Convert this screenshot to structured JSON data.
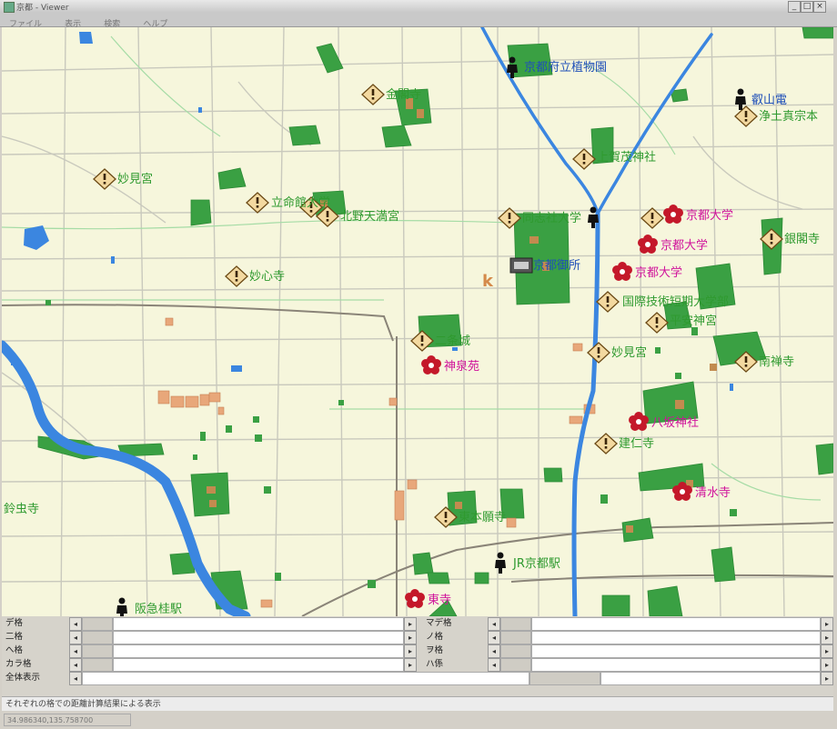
{
  "window": {
    "title": "京都 - Viewer"
  },
  "menu": [
    "ファイル",
    "表示",
    "検索",
    "ヘルプ"
  ],
  "map_labels": {
    "green": [
      {
        "id": "kinkakuji",
        "text": "金閣寺"
      },
      {
        "id": "myokenguu1",
        "text": "妙見宮"
      },
      {
        "id": "ritsumeikan",
        "text": "立命館大学"
      },
      {
        "id": "kitano",
        "text": "北野天満宮"
      },
      {
        "id": "kamigamo",
        "text": "上賀茂神社"
      },
      {
        "id": "doshisha",
        "text": "同志社大学"
      },
      {
        "id": "myoshinji",
        "text": "妙心寺"
      },
      {
        "id": "heian",
        "text": "平安神宮"
      },
      {
        "id": "nijo",
        "text": "二条城"
      },
      {
        "id": "myokenguu2",
        "text": "妙見宮"
      },
      {
        "id": "nanzenji",
        "text": "南禅寺"
      },
      {
        "id": "kenninji",
        "text": "建仁寺"
      },
      {
        "id": "higashihonganji",
        "text": "東本願寺"
      },
      {
        "id": "suzumushi",
        "text": "鈴虫寺"
      },
      {
        "id": "ginkakuji",
        "text": "銀閣寺"
      },
      {
        "id": "kokusai",
        "text": "国際技術短期大学部"
      }
    ],
    "blue": [
      {
        "id": "botanical",
        "text": "京都府立植物園"
      },
      {
        "id": "eizan",
        "text": "叡山電"
      },
      {
        "id": "jodoshin",
        "text": "浄土真宗本"
      },
      {
        "id": "gosho",
        "text": "京都御所"
      },
      {
        "id": "kyotostation",
        "text": "JR京都駅"
      },
      {
        "id": "hankyu",
        "text": "阪急桂駅"
      }
    ],
    "magenta": [
      {
        "id": "kyodai1",
        "text": "京都大学"
      },
      {
        "id": "kyodai2",
        "text": "京都大学"
      },
      {
        "id": "kyodai3",
        "text": "京都大学"
      },
      {
        "id": "shinsenen",
        "text": "神泉苑"
      },
      {
        "id": "yasaka",
        "text": "八坂神社"
      },
      {
        "id": "kiyomizu",
        "text": "清水寺"
      },
      {
        "id": "toji",
        "text": "東寺"
      }
    ]
  },
  "panel": {
    "left_rows": [
      "デ格",
      "二格",
      "へ格",
      "カラ格",
      "全体表示"
    ],
    "right_rows": [
      "マデ格",
      "ノ格",
      "ヲ格",
      "ハ係"
    ]
  },
  "status": {
    "message": "それぞれの格での距離計算結果による表示",
    "coords": "34.986340,135.758700"
  },
  "colors": {
    "river": "#3b86e0",
    "park": "#3aa043",
    "road": "#c9c9bd",
    "background": "#f6f6dc",
    "label_green": "#2f9a2f",
    "label_blue": "#1f4fb8",
    "label_magenta": "#d0139b"
  }
}
